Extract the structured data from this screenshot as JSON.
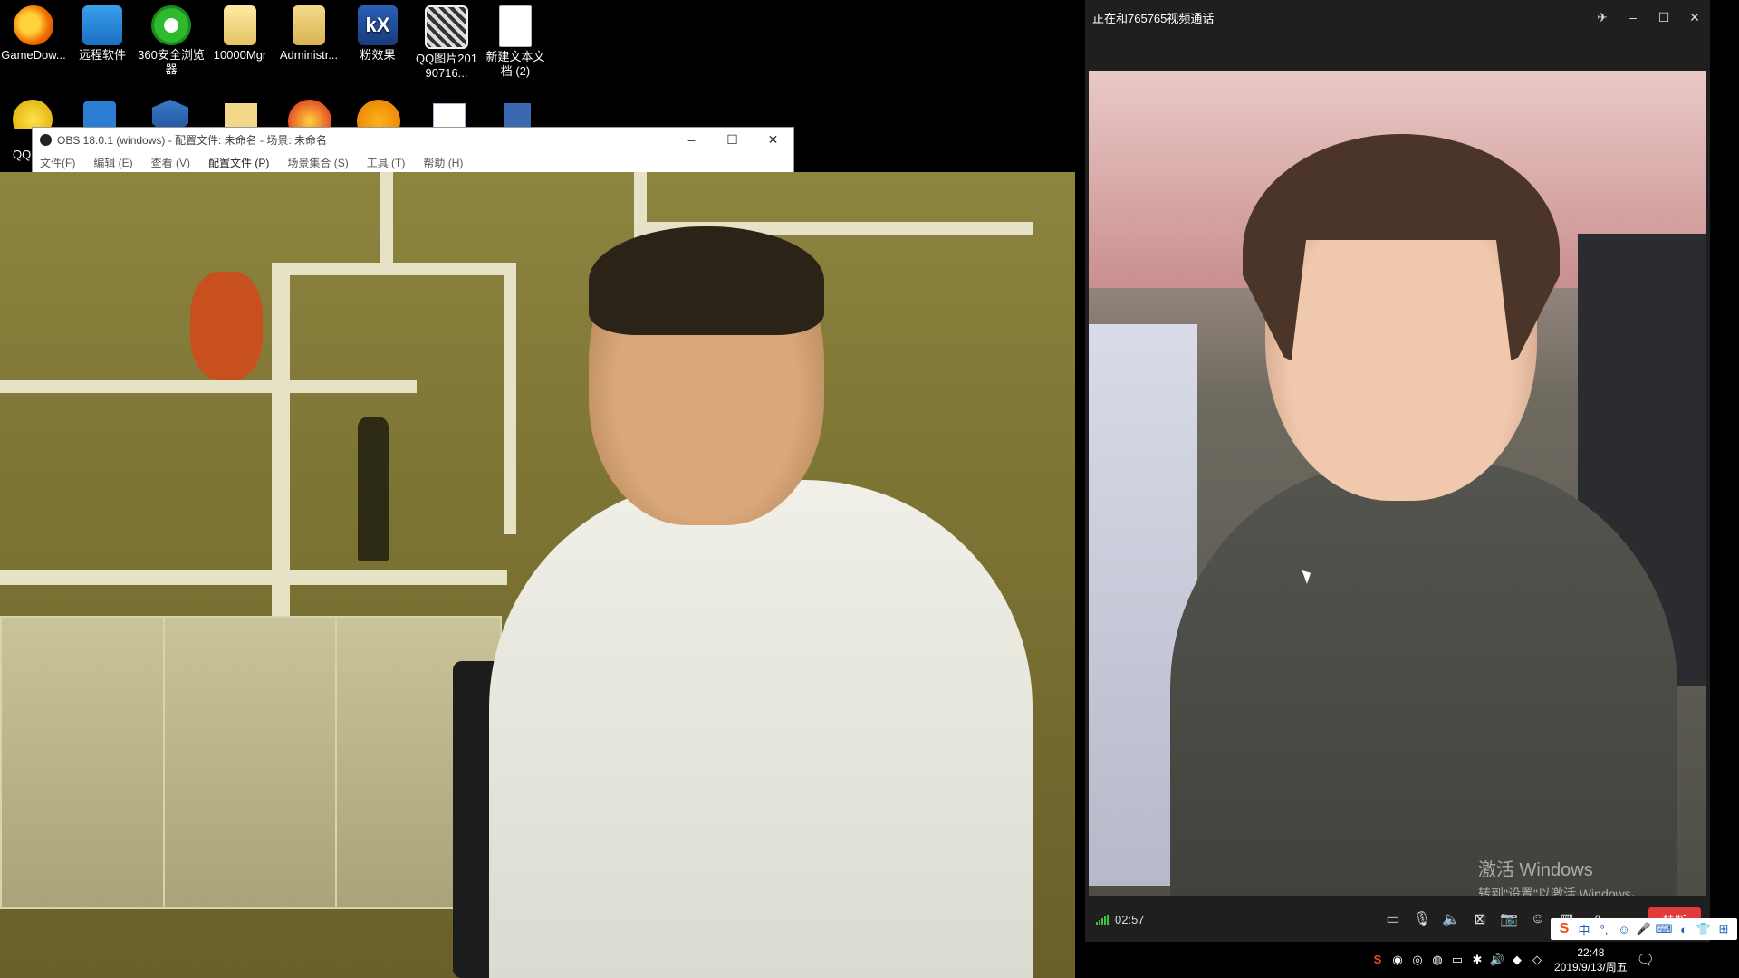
{
  "desktop": {
    "icons": [
      {
        "label": "GameDow..."
      },
      {
        "label": "远程软件"
      },
      {
        "label": "360安全浏览器"
      },
      {
        "label": "10000Mgr"
      },
      {
        "label": "Administr..."
      },
      {
        "label": "粉效果"
      },
      {
        "label": "QQ图片20190716..."
      },
      {
        "label": "新建文本文档 (2)"
      }
    ],
    "row2_first_label": "QQ"
  },
  "obs": {
    "title": "OBS 18.0.1 (windows) - 配置文件: 未命名 - 场景: 未命名",
    "menu": [
      "文件(F)",
      "编辑 (E)",
      "查看 (V)",
      "配置文件 (P)",
      "场景集合 (S)",
      "工具 (T)",
      "帮助 (H)"
    ]
  },
  "video_call": {
    "title": "正在和765765视频通话",
    "timer": "02:57",
    "hangup_label": "挂断",
    "watermark_line1": "激活 Windows",
    "watermark_line2": "转到\"设置\"以激活 Windows。"
  },
  "taskbar": {
    "time": "22:48",
    "date": "2019/9/13/周五"
  },
  "ime": {
    "lang": "中"
  }
}
